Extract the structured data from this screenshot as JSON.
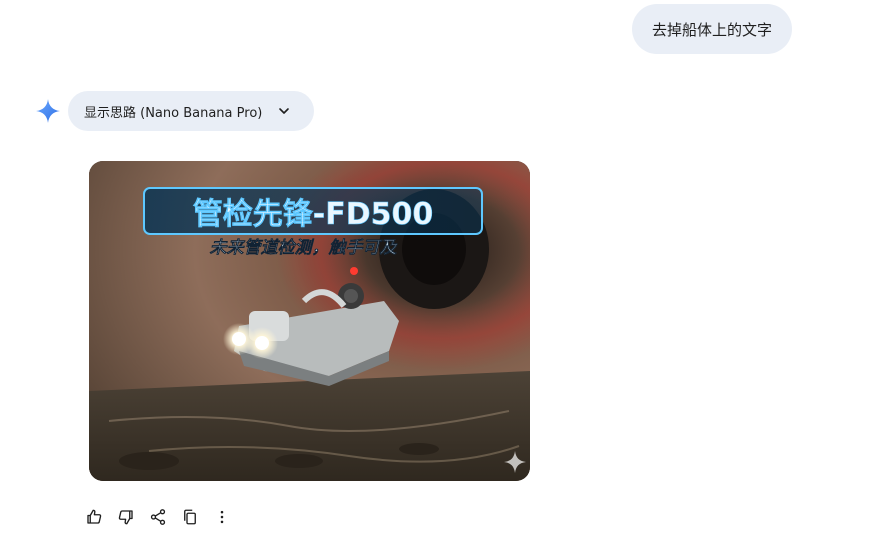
{
  "user_message": {
    "text": "去掉船体上的文字"
  },
  "assistant": {
    "thinking_chip_label": "显示思路 (Nano Banana Pro)",
    "image": {
      "title_text": "管检先锋-FD500",
      "subtitle_text": "未来管道检测，触手可及"
    }
  },
  "actions": [
    {
      "icon": "thumbs-up-icon"
    },
    {
      "icon": "thumbs-down-icon"
    },
    {
      "icon": "share-icon"
    },
    {
      "icon": "copy-icon"
    },
    {
      "icon": "more-vertical-icon"
    }
  ],
  "colors": {
    "bubble_bg": "#e9eef6",
    "spark_blue": "#4285f4",
    "title_glow": "#5ec8ff"
  }
}
